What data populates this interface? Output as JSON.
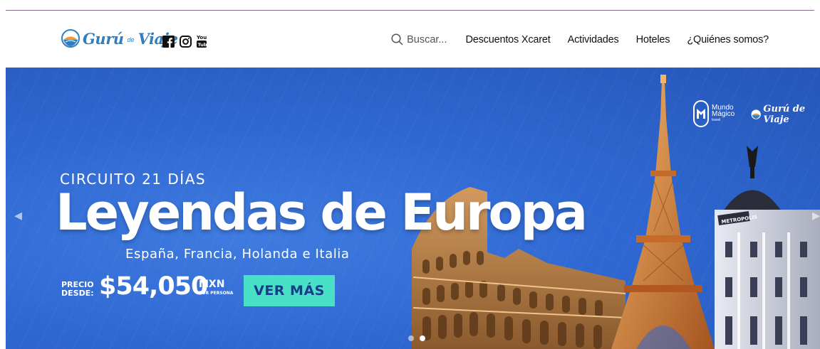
{
  "header": {
    "logo": {
      "text_main": "Gurú",
      "text_small": "de",
      "text_end": "Viaje"
    },
    "social": [
      {
        "icon": "facebook-icon"
      },
      {
        "icon": "instagram-icon"
      },
      {
        "icon": "youtube-icon"
      }
    ],
    "search": {
      "placeholder": "Buscar..."
    },
    "nav": [
      {
        "label": "Descuentos Xcaret"
      },
      {
        "label": "Actividades"
      },
      {
        "label": "Hoteles"
      },
      {
        "label": "¿Quiénes somos?"
      }
    ]
  },
  "hero": {
    "kicker": "CIRCUITO 21 DÍAS",
    "title": "Leyendas de Europa",
    "subtitle": "España, Francia, Holanda e Italia",
    "price_label_line1": "PRECIO",
    "price_label_line2": "DESDE:",
    "price": "$54,050",
    "currency": "MXN",
    "per_person": "POR PERSONA",
    "cta": "VER MÁS",
    "partner_brand": {
      "line1": "Mundo",
      "line2": "Mágico",
      "line3": "travel"
    },
    "partner_brand_2": "Gurú de Viaje",
    "building_sign": "METROPOLIS",
    "slides": {
      "count": 2,
      "active": 2
    },
    "colors": {
      "background": "#2f68d2",
      "cta": "#49e0c8",
      "cta_text": "#1a3a8a"
    }
  },
  "colors": {
    "brand": "#2f7fc0",
    "nav_text": "#111111"
  }
}
